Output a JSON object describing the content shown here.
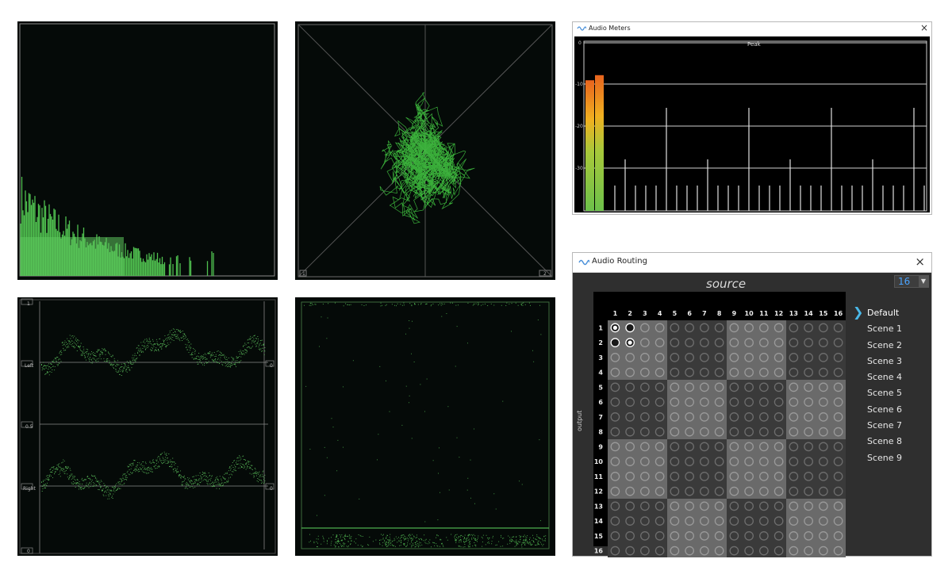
{
  "meters_window": {
    "title": "Audio Meters",
    "peak_label": "Peak",
    "scale_labels": [
      "0",
      "-10",
      "-20",
      "-30"
    ],
    "bar_levels": [
      0.77,
      0.8
    ],
    "colors": {
      "green": "#6cc04a",
      "orange": "#e8641e"
    }
  },
  "routing_window": {
    "title": "Audio Routing",
    "source_label": "source",
    "output_label": "output",
    "channel_count": "16",
    "columns": [
      "1",
      "2",
      "3",
      "4",
      "5",
      "6",
      "7",
      "8",
      "9",
      "10",
      "11",
      "12",
      "13",
      "14",
      "15",
      "16"
    ],
    "rows": [
      "1",
      "2",
      "3",
      "4",
      "5",
      "6",
      "7",
      "8",
      "9",
      "10",
      "11",
      "12",
      "13",
      "14",
      "15",
      "16"
    ],
    "active_routes": [
      [
        1,
        1
      ],
      [
        1,
        2
      ],
      [
        2,
        1
      ],
      [
        2,
        2
      ]
    ],
    "scenes": [
      "Default",
      "Scene 1",
      "Scene 2",
      "Scene 3",
      "Scene 4",
      "Scene 5",
      "Scene 6",
      "Scene 7",
      "Scene 8",
      "Scene 9"
    ],
    "active_scene": "Default"
  },
  "scope_panels": {
    "lissajous_corner_labels": [
      "1",
      "2"
    ],
    "dual_trace_labels": [
      "1",
      "Left",
      "0.5",
      "Right",
      "0"
    ],
    "dual_trace_right_labels": [
      "0",
      "0"
    ]
  },
  "colors": {
    "trace_green": "#5fd85f",
    "panel_bg": "#050a08",
    "frame_gray": "#9a9a9a"
  }
}
